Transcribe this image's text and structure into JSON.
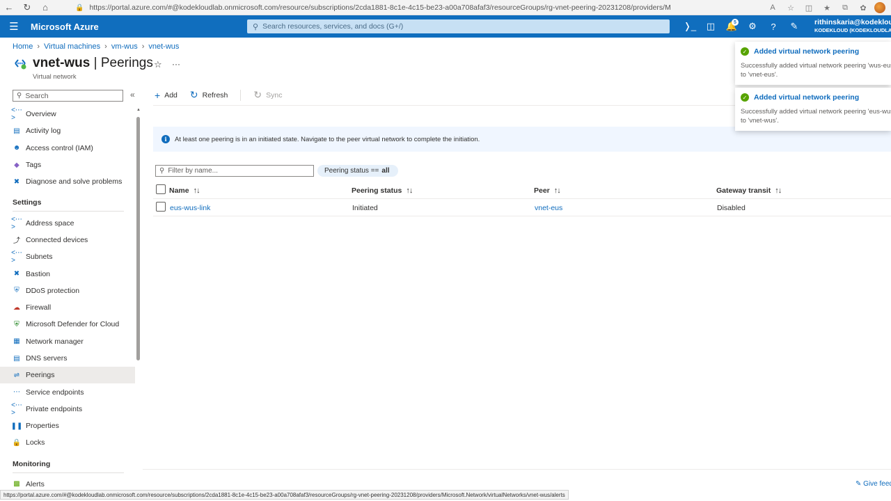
{
  "browser": {
    "url": "https://portal.azure.com/#@kodekloudlab.onmicrosoft.com/resource/subscriptions/2cda1881-8c1e-4c15-be23-a00a708afaf3/resourceGroups/rg-vnet-peering-20231208/providers/Microsoft.Ne..."
  },
  "topbar": {
    "brand": "Microsoft Azure",
    "search_placeholder": "Search resources, services, and docs (G+/)",
    "notification_count": "5",
    "user_name": "rithinskaria@kodekloud",
    "user_directory": "KODEKLOUD (KODEKLOUDLAB.ONMICROSOFT.COM)"
  },
  "breadcrumb": [
    "Home",
    "Virtual machines",
    "vm-wus",
    "vnet-wus"
  ],
  "header": {
    "resource_name": "vnet-wus",
    "separator": "|",
    "page_name": "Peerings",
    "subtitle": "Virtual network"
  },
  "sidebar": {
    "search_placeholder": "Search",
    "items_top": [
      "Overview",
      "Activity log",
      "Access control (IAM)",
      "Tags",
      "Diagnose and solve problems"
    ],
    "settings_label": "Settings",
    "settings_items": [
      "Address space",
      "Connected devices",
      "Subnets",
      "Bastion",
      "DDoS protection",
      "Firewall",
      "Microsoft Defender for Cloud",
      "Network manager",
      "DNS servers",
      "Peerings",
      "Service endpoints",
      "Private endpoints",
      "Properties",
      "Locks"
    ],
    "monitoring_label": "Monitoring",
    "monitoring_items": [
      "Alerts"
    ]
  },
  "commandbar": {
    "add": "Add",
    "refresh": "Refresh",
    "sync": "Sync"
  },
  "info_banner": "At least one peering is in an initiated state. Navigate to the peer virtual network to complete the initiation.",
  "filter": {
    "placeholder": "Filter by name...",
    "pill_label": "Peering status ==",
    "pill_value": "all"
  },
  "table": {
    "columns": [
      "Name",
      "Peering status",
      "Peer",
      "Gateway transit"
    ],
    "rows": [
      {
        "name": "eus-wus-link",
        "status": "Initiated",
        "peer": "vnet-eus",
        "gateway": "Disabled"
      }
    ]
  },
  "notifications": [
    {
      "title": "Added virtual network peering",
      "body": "Successfully added virtual network peering 'wus-eus-link' to 'vnet-eus'."
    },
    {
      "title": "Added virtual network peering",
      "body": "Successfully added virtual network peering 'eus-wus-link' to 'vnet-wus'."
    }
  ],
  "feedback": "Give feedback",
  "status_url": "https://portal.azure.com/#@kodekloudlab.onmicrosoft.com/resource/subscriptions/2cda1881-8c1e-4c15-be23-a00a708afaf3/resourceGroups/rg-vnet-peering-20231208/providers/Microsoft.Network/virtualNetworks/vnet-wus/alerts",
  "colors": {
    "azure_blue": "#106ebe",
    "link": "#0f6cbd",
    "success": "#57a300"
  }
}
